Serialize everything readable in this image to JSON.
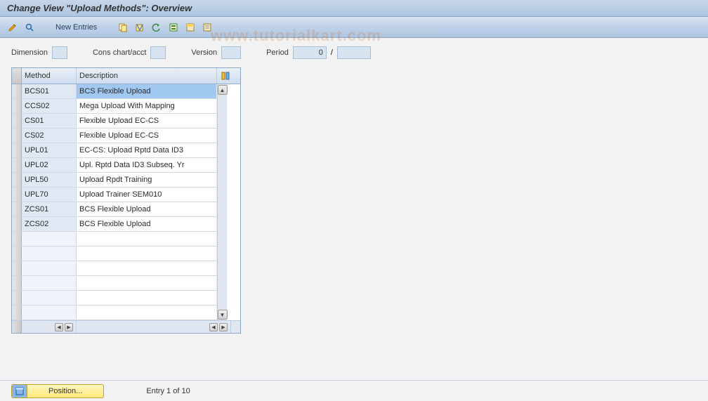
{
  "title": "Change View \"Upload Methods\": Overview",
  "watermark": "www.tutorialkart.com",
  "toolbar": {
    "new_entries": "New Entries"
  },
  "filters": {
    "dimension_label": "Dimension",
    "dimension_value": "",
    "cons_label": "Cons chart/acct",
    "cons_value": "",
    "version_label": "Version",
    "version_value": "",
    "period_label": "Period",
    "period_value": "0",
    "period_sep": "/",
    "period_year": ""
  },
  "grid": {
    "col_method": "Method",
    "col_description": "Description",
    "rows": [
      {
        "method": "BCS01",
        "description": "BCS Flexible Upload",
        "selected": true
      },
      {
        "method": "CCS02",
        "description": "Mega Upload With Mapping",
        "selected": false
      },
      {
        "method": "CS01",
        "description": "Flexible Upload EC-CS",
        "selected": false
      },
      {
        "method": "CS02",
        "description": "Flexible Upload EC-CS",
        "selected": false
      },
      {
        "method": "UPL01",
        "description": "EC-CS: Upload Rptd Data  ID3",
        "selected": false
      },
      {
        "method": "UPL02",
        "description": "Upl. Rptd Data ID3 Subseq. Yr",
        "selected": false
      },
      {
        "method": "UPL50",
        "description": "Upload Rpdt Training",
        "selected": false
      },
      {
        "method": "UPL70",
        "description": "Upload Trainer SEM010",
        "selected": false
      },
      {
        "method": "ZCS01",
        "description": "BCS Flexible Upload",
        "selected": false
      },
      {
        "method": "ZCS02",
        "description": "BCS Flexible Upload",
        "selected": false
      }
    ],
    "empty_rows": 6
  },
  "footer": {
    "position_label": "Position...",
    "entry_text": "Entry 1 of 10"
  }
}
